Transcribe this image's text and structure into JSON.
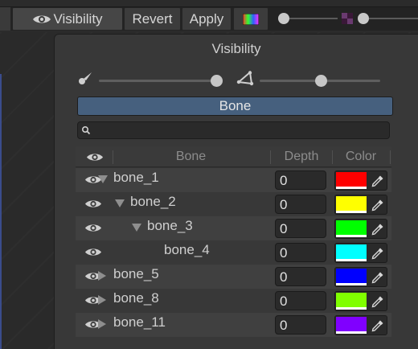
{
  "toolbar": {
    "visibility_label": "Visibility",
    "revert_label": "Revert",
    "apply_label": "Apply"
  },
  "panel": {
    "title": "Visibility",
    "tab_label": "Bone",
    "search": {
      "value": "",
      "placeholder": ""
    },
    "sliders": [
      {
        "icon": "brush-icon",
        "level_fraction": 0.98
      },
      {
        "icon": "polygon-icon",
        "level_fraction": 0.56
      }
    ]
  },
  "table": {
    "headers": {
      "visibility": "eye-icon",
      "bone": "Bone",
      "depth": "Depth",
      "color": "Color"
    },
    "rows": [
      {
        "name": "bone_1",
        "depth": "0",
        "color": "#ff0000",
        "level": 0,
        "expander": "expanded"
      },
      {
        "name": "bone_2",
        "depth": "0",
        "color": "#ffff00",
        "level": 1,
        "expander": "expanded"
      },
      {
        "name": "bone_3",
        "depth": "0",
        "color": "#00ff00",
        "level": 2,
        "expander": "expanded"
      },
      {
        "name": "bone_4",
        "depth": "0",
        "color": "#00ffff",
        "level": 3,
        "expander": "none"
      },
      {
        "name": "bone_5",
        "depth": "0",
        "color": "#0000ff",
        "level": 0,
        "expander": "collapsed"
      },
      {
        "name": "bone_8",
        "depth": "0",
        "color": "#80ff00",
        "level": 0,
        "expander": "collapsed"
      },
      {
        "name": "bone_11",
        "depth": "0",
        "color": "#8000ff",
        "level": 0,
        "expander": "collapsed"
      }
    ]
  }
}
